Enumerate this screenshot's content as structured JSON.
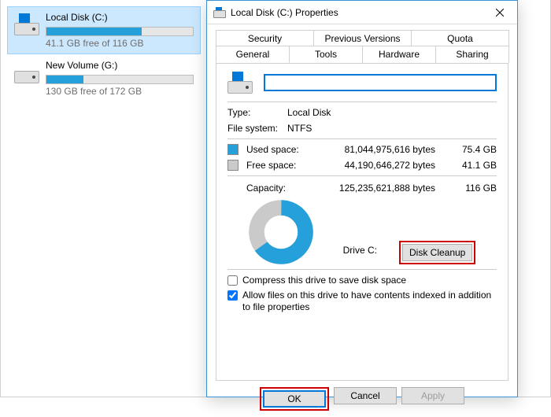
{
  "explorer": {
    "drives": [
      {
        "name": "Local Disk (C:)",
        "free_text": "41.1 GB free of 116 GB",
        "fill_pct": 65
      },
      {
        "name": "New Volume (G:)",
        "free_text": "130 GB free of 172 GB",
        "fill_pct": 25
      }
    ]
  },
  "dialog": {
    "title": "Local Disk (C:) Properties",
    "tabs_back": [
      "Security",
      "Previous Versions",
      "Quota"
    ],
    "tabs_front": [
      "General",
      "Tools",
      "Hardware",
      "Sharing"
    ],
    "active_tab": "General",
    "name_value": "",
    "type_label": "Type:",
    "type_value": "Local Disk",
    "fs_label": "File system:",
    "fs_value": "NTFS",
    "used_label": "Used space:",
    "used_bytes": "81,044,975,616 bytes",
    "used_gb": "75.4 GB",
    "free_label": "Free space:",
    "free_bytes": "44,190,646,272 bytes",
    "free_gb": "41.1 GB",
    "capacity_label": "Capacity:",
    "capacity_bytes": "125,235,621,888 bytes",
    "capacity_gb": "116 GB",
    "drive_label": "Drive C:",
    "cleanup_label": "Disk Cleanup",
    "compress_label": "Compress this drive to save disk space",
    "index_label": "Allow files on this drive to have contents indexed in addition to file properties",
    "compress_checked": false,
    "index_checked": true,
    "ok_label": "OK",
    "cancel_label": "Cancel",
    "apply_label": "Apply"
  },
  "colors": {
    "used": "#26a0da",
    "free": "#cacaca",
    "accent": "#0078d7",
    "highlight_border": "#cc0000"
  },
  "chart_data": {
    "type": "pie",
    "title": "Drive C:",
    "categories": [
      "Used space",
      "Free space"
    ],
    "values": [
      75.4,
      41.1
    ],
    "series": [
      {
        "name": "Used space",
        "value_bytes": 81044975616,
        "value_gb": 75.4,
        "color": "#26a0da"
      },
      {
        "name": "Free space",
        "value_bytes": 44190646272,
        "value_gb": 41.1,
        "color": "#cacaca"
      }
    ],
    "total_gb": 116,
    "used_pct": 65
  }
}
